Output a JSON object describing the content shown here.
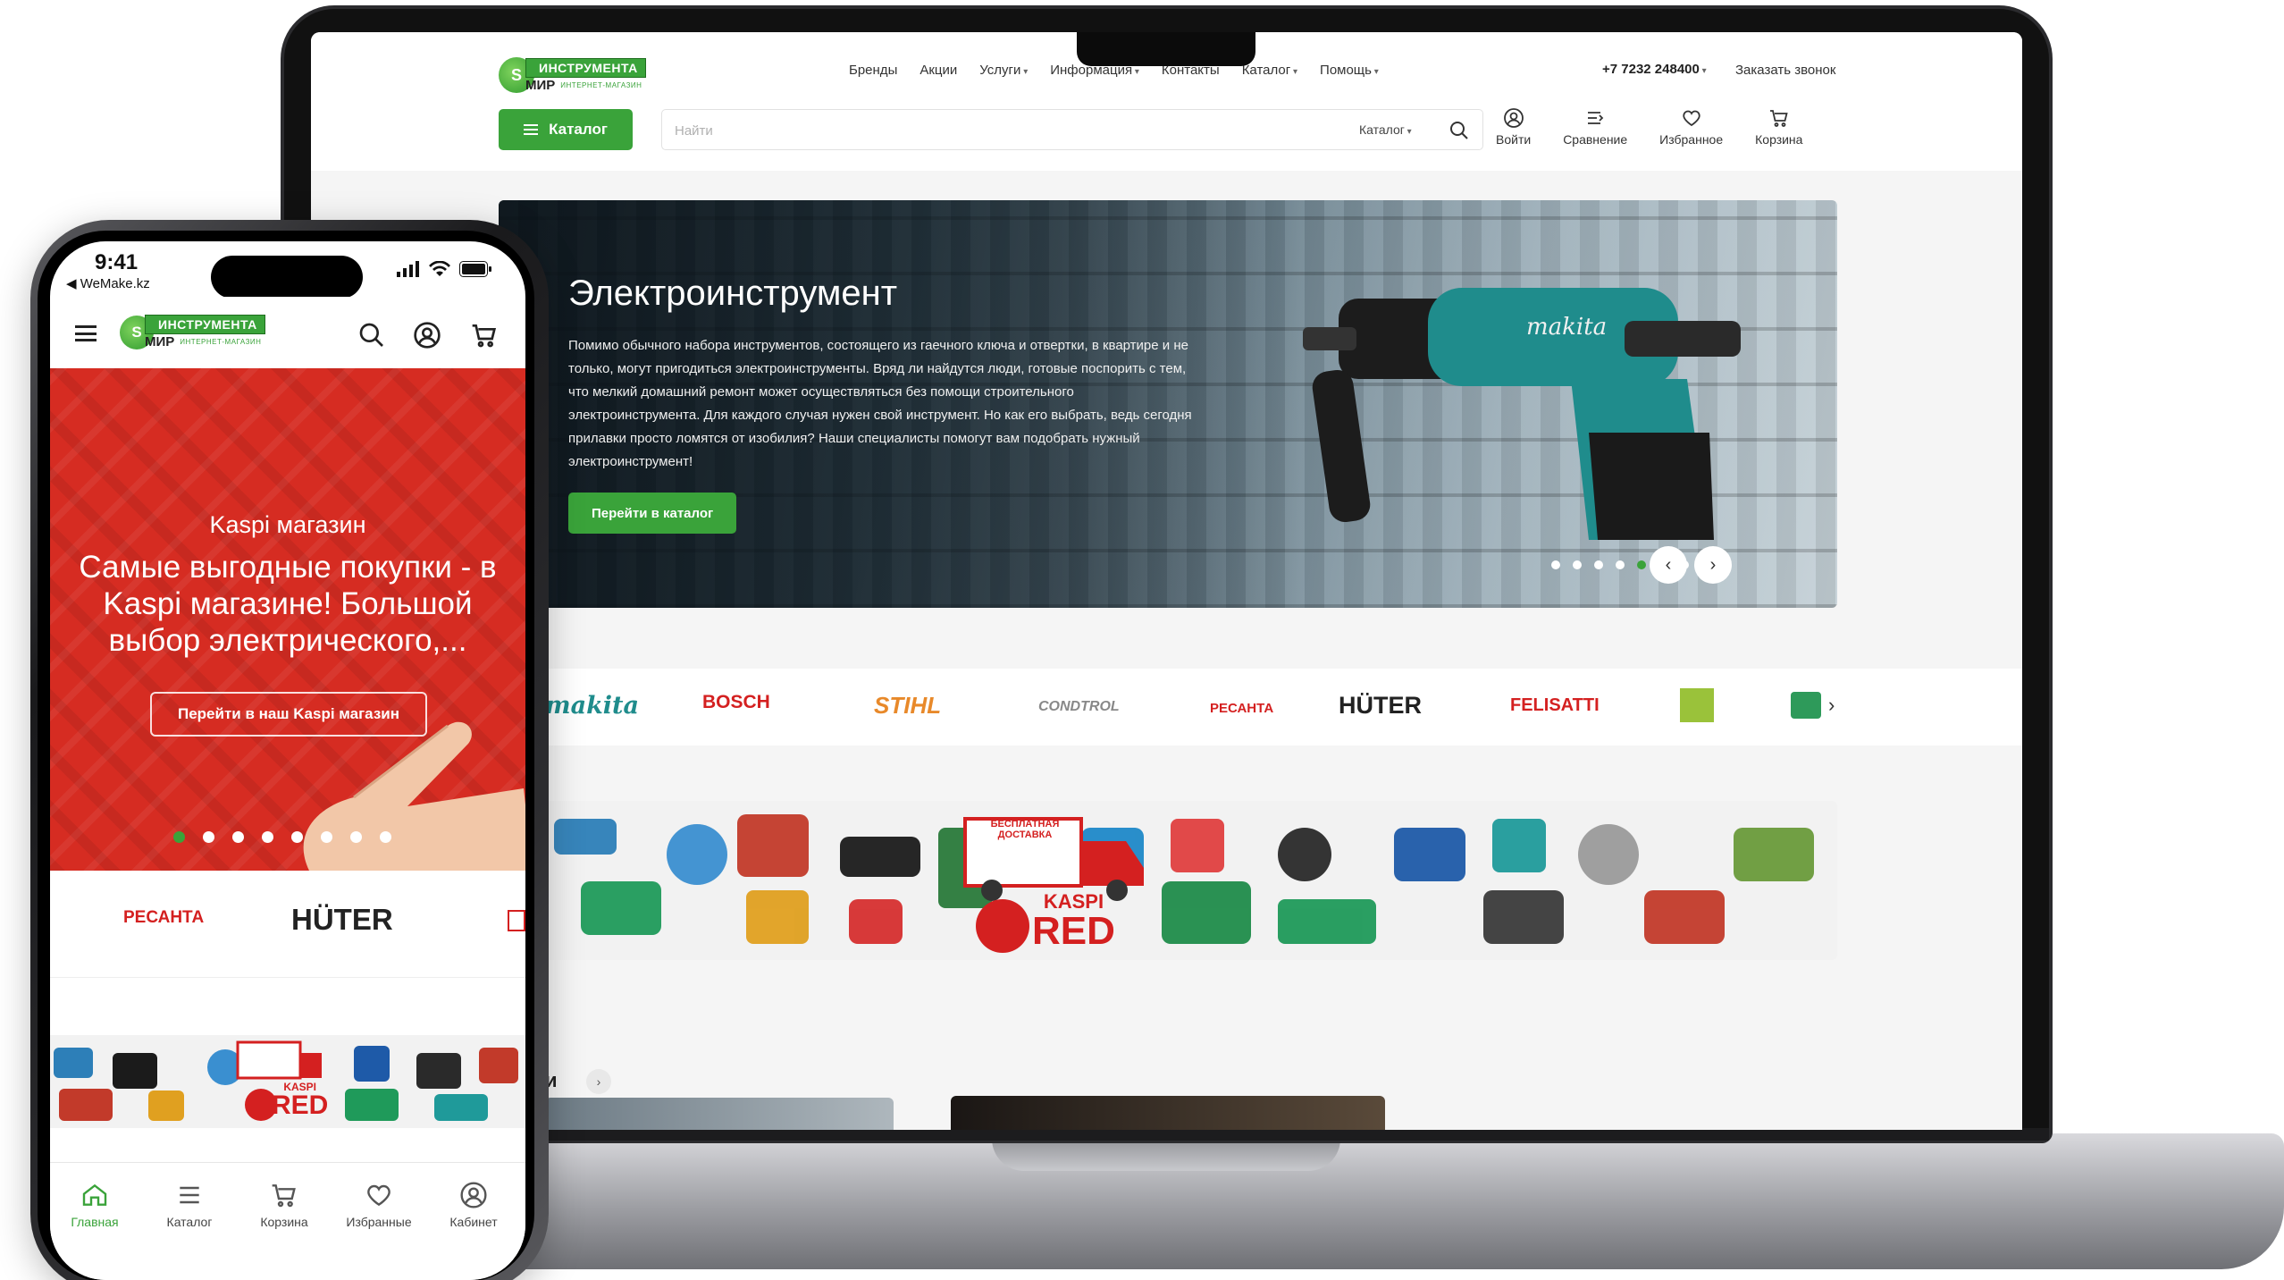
{
  "brand_logo": {
    "top": "ИНСТРУМЕНТА",
    "mir": "МИР",
    "sub": "ИНТЕРНЕТ-МАГАЗИН"
  },
  "desktop": {
    "nav": [
      "Бренды",
      "Акции",
      "Услуги",
      "Информация",
      "Контакты",
      "Каталог",
      "Помощь"
    ],
    "phone": "+7 7232 248400",
    "callback": "Заказать звонок",
    "catalog_button": "Каталог",
    "search": {
      "placeholder": "Найти",
      "scope": "Каталог"
    },
    "actions": {
      "login": "Войти",
      "compare": "Сравнение",
      "favorites": "Избранное",
      "cart": "Корзина"
    },
    "hero": {
      "title": "Электроинструмент",
      "text": "Помимо обычного набора инструментов, состоящего из гаечного ключа и отвертки, в квартире и не только, могут пригодиться электроинструменты. Вряд ли найдутся люди, готовые поспорить с тем, что мелкий домашний ремонт может осуществляться без помощи строительного электроинструмента. Для каждого случая нужен свой инструмент. Но как его выбрать, ведь сегодня прилавки просто ломятся от изобилия? Наши специалисты помогут вам подобрать нужный электроинструмент!",
      "button": "Перейти в каталог",
      "slide_count": 8,
      "active_slide": 5,
      "product_brand": "makita"
    },
    "brands": [
      "makita",
      "BOSCH",
      "STIHL",
      "CONDTROL",
      "РЕСАНТА",
      "HÜTER",
      "FELISATTI"
    ],
    "promo": {
      "free_delivery": "БЕСПЛАТНАЯ ДОСТАВКА",
      "kaspi": "KASPI",
      "red": "RED"
    },
    "section_fragment": "и"
  },
  "mobile": {
    "time": "9:41",
    "back_label": "◀ WeMake.kz",
    "hero": {
      "subtitle": "Kaspi магазин",
      "title": "Самые выгодные покупки - в Kaspi магазине! Большой выбор электрического,...",
      "button": "Перейти в наш Kaspi магазин",
      "slide_count": 8,
      "active_slide": 1
    },
    "brands": [
      "РЕСАНТА",
      "HÜTER"
    ],
    "promo": {
      "kaspi": "KASPI",
      "red": "RED"
    },
    "tabs": [
      "Главная",
      "Каталог",
      "Корзина",
      "Избранные",
      "Кабинет"
    ]
  },
  "colors": {
    "accent": "#3aa33a",
    "kaspi_red": "#d62c22"
  }
}
